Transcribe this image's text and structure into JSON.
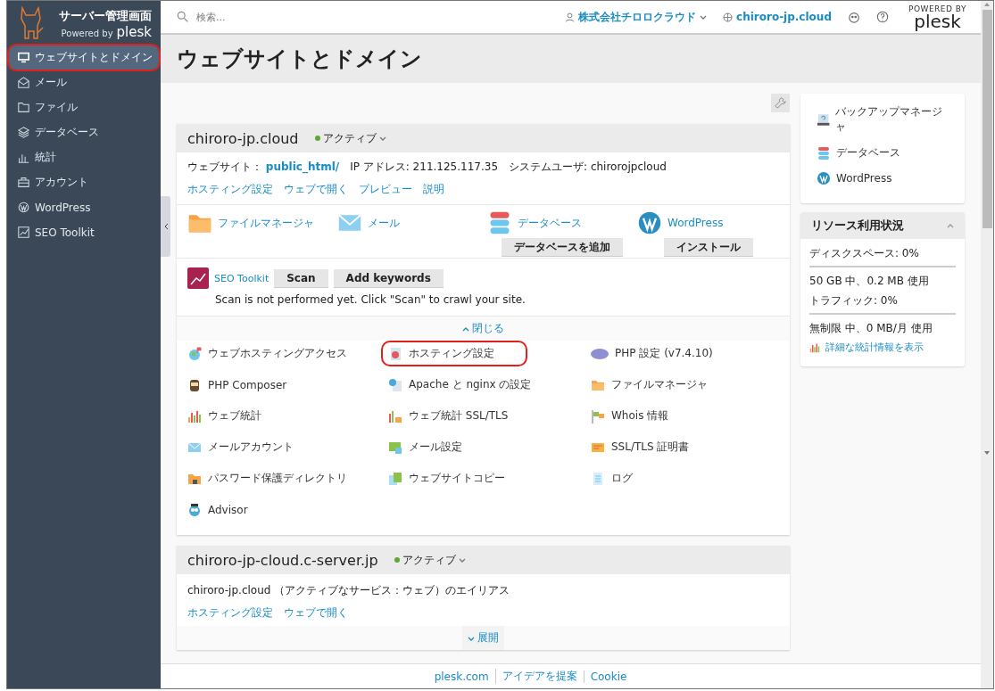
{
  "sidebar": {
    "logo": {
      "title": "サーバー管理画面",
      "powered": "Powered by",
      "brand": "plesk"
    },
    "items": [
      {
        "label": "ウェブサイトとドメイン",
        "selected": true,
        "highlighted": true
      },
      {
        "label": "メール",
        "selected": false,
        "highlighted": false
      },
      {
        "label": "ファイル",
        "selected": false,
        "highlighted": false
      },
      {
        "label": "データベース",
        "selected": false,
        "highlighted": false
      },
      {
        "label": "統計",
        "selected": false,
        "highlighted": false
      },
      {
        "label": "アカウント",
        "selected": false,
        "highlighted": false
      },
      {
        "label": "WordPress",
        "selected": false,
        "highlighted": false
      },
      {
        "label": "SEO Toolkit",
        "selected": false,
        "highlighted": false
      }
    ]
  },
  "topbar": {
    "search": {
      "placeholder": "検索..."
    },
    "account": "株式会社チロロクラウド",
    "domain": "chiroro-jp.cloud",
    "brand": {
      "powered": "POWERED BY",
      "name": "plesk"
    }
  },
  "page_title": "ウェブサイトとドメイン",
  "domains": [
    {
      "name": "chiroro-jp.cloud",
      "status": "アクティブ",
      "expanded": true,
      "info": {
        "website_label": "ウェブサイト：",
        "website_link": "public_html/",
        "ip": "IP アドレス: 211.125.117.35",
        "user": "システムユーザ: chirorojpcloud"
      },
      "links": [
        "ホスティング設定",
        "ウェブで開く",
        "プレビュー",
        "説明"
      ],
      "apps": [
        {
          "label": "ファイルマネージャ"
        },
        {
          "label": "メール"
        },
        {
          "label": "データベース",
          "button": "データベースを追加"
        },
        {
          "label": "WordPress",
          "button": "インストール"
        }
      ],
      "seo": {
        "label": "SEO Toolkit",
        "buttons": [
          "Scan",
          "Add keywords"
        ],
        "message": "Scan is not performed yet. Click \"Scan\" to crawl your site."
      },
      "toggle": "閉じる",
      "tools": [
        {
          "label": "ウェブホスティングアクセス",
          "highlighted": false
        },
        {
          "label": "ホスティング設定",
          "highlighted": true
        },
        {
          "label": "PHP 設定 (v7.4.10)",
          "highlighted": false
        },
        {
          "label": "PHP Composer",
          "highlighted": false
        },
        {
          "label": "Apache と nginx の設定",
          "highlighted": false
        },
        {
          "label": "ファイルマネージャ",
          "highlighted": false
        },
        {
          "label": "ウェブ統計",
          "highlighted": false
        },
        {
          "label": "ウェブ統計 SSL/TLS",
          "highlighted": false
        },
        {
          "label": "Whois 情報",
          "highlighted": false
        },
        {
          "label": "メールアカウント",
          "highlighted": false
        },
        {
          "label": "メール設定",
          "highlighted": false
        },
        {
          "label": "SSL/TLS 証明書",
          "highlighted": false
        },
        {
          "label": "パスワード保護ディレクトリ",
          "highlighted": false
        },
        {
          "label": "ウェブサイトコピー",
          "highlighted": false
        },
        {
          "label": "ログ",
          "highlighted": false
        },
        {
          "label": "Advisor",
          "highlighted": false
        }
      ]
    },
    {
      "name": "chiroro-jp-cloud.c-server.jp",
      "status": "アクティブ",
      "expanded": false,
      "alias": "chiroro-jp.cloud （アクティブなサービス：ウェブ）のエイリアス",
      "links": [
        "ホスティング設定",
        "ウェブで開く"
      ],
      "toggle": "展開"
    }
  ],
  "quick_links": [
    "バックアップマネージャ",
    "データベース",
    "WordPress"
  ],
  "resources": {
    "title": "リソース利用状況",
    "expanded": true,
    "rows": [
      {
        "label": "ディスクスペース: 0%",
        "level": 0,
        "detail": "50 GB 中、0.2 MB 使用"
      },
      {
        "label": "トラフィック: 0%",
        "level": 0,
        "detail": "無制限 中、0 MB/月 使用"
      }
    ],
    "link": "詳細な統計情報を表示"
  },
  "footer": [
    "plesk.com",
    "アイデアを提案",
    "Cookie"
  ]
}
